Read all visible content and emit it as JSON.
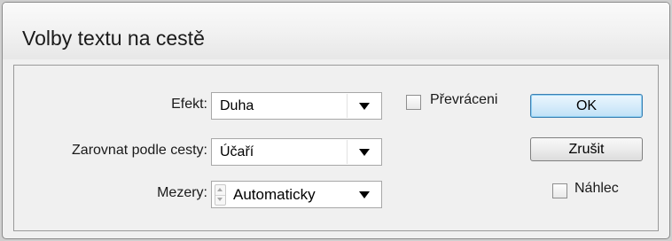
{
  "dialog": {
    "title": "Volby textu na cestě"
  },
  "effect": {
    "label": "Efekt:",
    "value": "Duha"
  },
  "align": {
    "label": "Zarovnat podle cesty:",
    "value": "Účaří"
  },
  "spacing": {
    "label": "Mezery:",
    "value": "Automaticky"
  },
  "flip": {
    "label": "Převráceni",
    "checked": false
  },
  "preview": {
    "label": "Náhlec",
    "checked": false
  },
  "buttons": {
    "ok": "OK",
    "cancel": "Zrušit"
  },
  "icons": {
    "dropdown": "chevron-down-icon",
    "spinner": "spinner-icon"
  },
  "colors": {
    "default_button": "#d7ecfa",
    "default_button_border": "#3c7fb1"
  }
}
